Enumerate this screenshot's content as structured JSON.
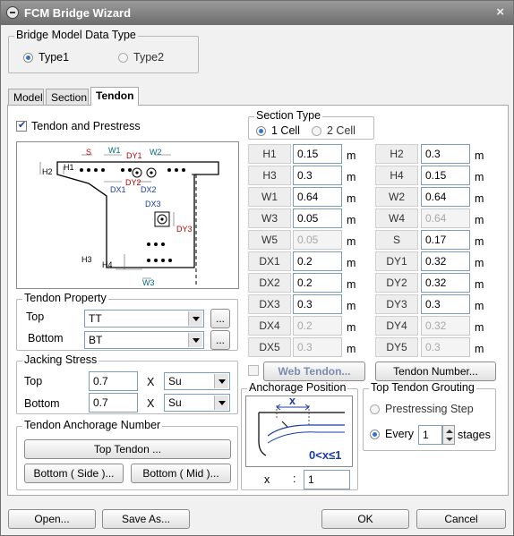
{
  "window": {
    "title": "FCM Bridge Wizard",
    "close": "×"
  },
  "model_type": {
    "label": "Bridge Model Data Type",
    "options": [
      {
        "label": "Type1",
        "selected": true
      },
      {
        "label": "Type2",
        "selected": false
      }
    ]
  },
  "tabs": [
    {
      "label": "Model"
    },
    {
      "label": "Section"
    },
    {
      "label": "Tendon",
      "active": true
    }
  ],
  "tendon": {
    "prestress_checkbox": {
      "label": "Tendon and Prestress",
      "checked": true
    },
    "diagram_labels": [
      "S",
      "W1",
      "DY1",
      "W2",
      "H2",
      "H1",
      "DX1",
      "DY2",
      "DX2",
      "DX3",
      "DY3",
      "H3",
      "H4",
      "W3"
    ],
    "section_type": {
      "label": "Section Type",
      "options": [
        {
          "label": "1 Cell",
          "selected": true
        },
        {
          "label": "2 Cell",
          "selected": false
        }
      ]
    },
    "params": [
      {
        "name": "H1",
        "value": "0.15",
        "unit": "m"
      },
      {
        "name": "H2",
        "value": "0.3",
        "unit": "m"
      },
      {
        "name": "H3",
        "value": "0.3",
        "unit": "m"
      },
      {
        "name": "H4",
        "value": "0.15",
        "unit": "m"
      },
      {
        "name": "W1",
        "value": "0.64",
        "unit": "m"
      },
      {
        "name": "W2",
        "value": "0.64",
        "unit": "m"
      },
      {
        "name": "W3",
        "value": "0.05",
        "unit": "m"
      },
      {
        "name": "W4",
        "value": "0.64",
        "unit": "m",
        "disabled": true
      },
      {
        "name": "W5",
        "value": "0.05",
        "unit": "m",
        "disabled": true
      },
      {
        "name": "S",
        "value": "0.17",
        "unit": "m"
      },
      {
        "name": "DX1",
        "value": "0.2",
        "unit": "m"
      },
      {
        "name": "DY1",
        "value": "0.32",
        "unit": "m"
      },
      {
        "name": "DX2",
        "value": "0.2",
        "unit": "m"
      },
      {
        "name": "DY2",
        "value": "0.32",
        "unit": "m"
      },
      {
        "name": "DX3",
        "value": "0.3",
        "unit": "m"
      },
      {
        "name": "DY3",
        "value": "0.3",
        "unit": "m"
      },
      {
        "name": "DX4",
        "value": "0.2",
        "unit": "m",
        "disabled": true
      },
      {
        "name": "DY4",
        "value": "0.32",
        "unit": "m",
        "disabled": true
      },
      {
        "name": "DX5",
        "value": "0.3",
        "unit": "m",
        "disabled": true
      },
      {
        "name": "DY5",
        "value": "0.3",
        "unit": "m",
        "disabled": true
      }
    ],
    "tendon_property": {
      "label": "Tendon Property",
      "top_label": "Top",
      "top_value": "TT",
      "bottom_label": "Bottom",
      "bottom_value": "BT",
      "browse": "..."
    },
    "jacking": {
      "label": "Jacking Stress",
      "top_label": "Top",
      "top_value": "0.7",
      "top_unit": "Su",
      "bottom_label": "Bottom",
      "bottom_value": "0.7",
      "bottom_unit": "Su",
      "times": "X"
    },
    "anchorage_number": {
      "label": "Tendon Anchorage Number",
      "top_button": "Top Tendon ...",
      "bottom_side_button": "Bottom ( Side )...",
      "bottom_mid_button": "Bottom ( Mid )..."
    },
    "web_tendon": {
      "label": "Web Tendon...",
      "checked": false
    },
    "tendon_number_button": "Tendon Number...",
    "anchorage_position": {
      "label": "Anchorage Position",
      "diagram_x": "x",
      "range_text": "0<x≤1",
      "x_label": "x",
      "colon": ":",
      "x_value": "1"
    },
    "grouting": {
      "label": "Top Tendon Grouting",
      "options": [
        {
          "label": "Prestressing Step",
          "selected": false
        },
        {
          "label": "Every",
          "selected": true
        }
      ],
      "every_value": "1",
      "stages_label": "stages"
    }
  },
  "footer": {
    "open": "Open...",
    "save_as": "Save As...",
    "ok": "OK",
    "cancel": "Cancel"
  }
}
